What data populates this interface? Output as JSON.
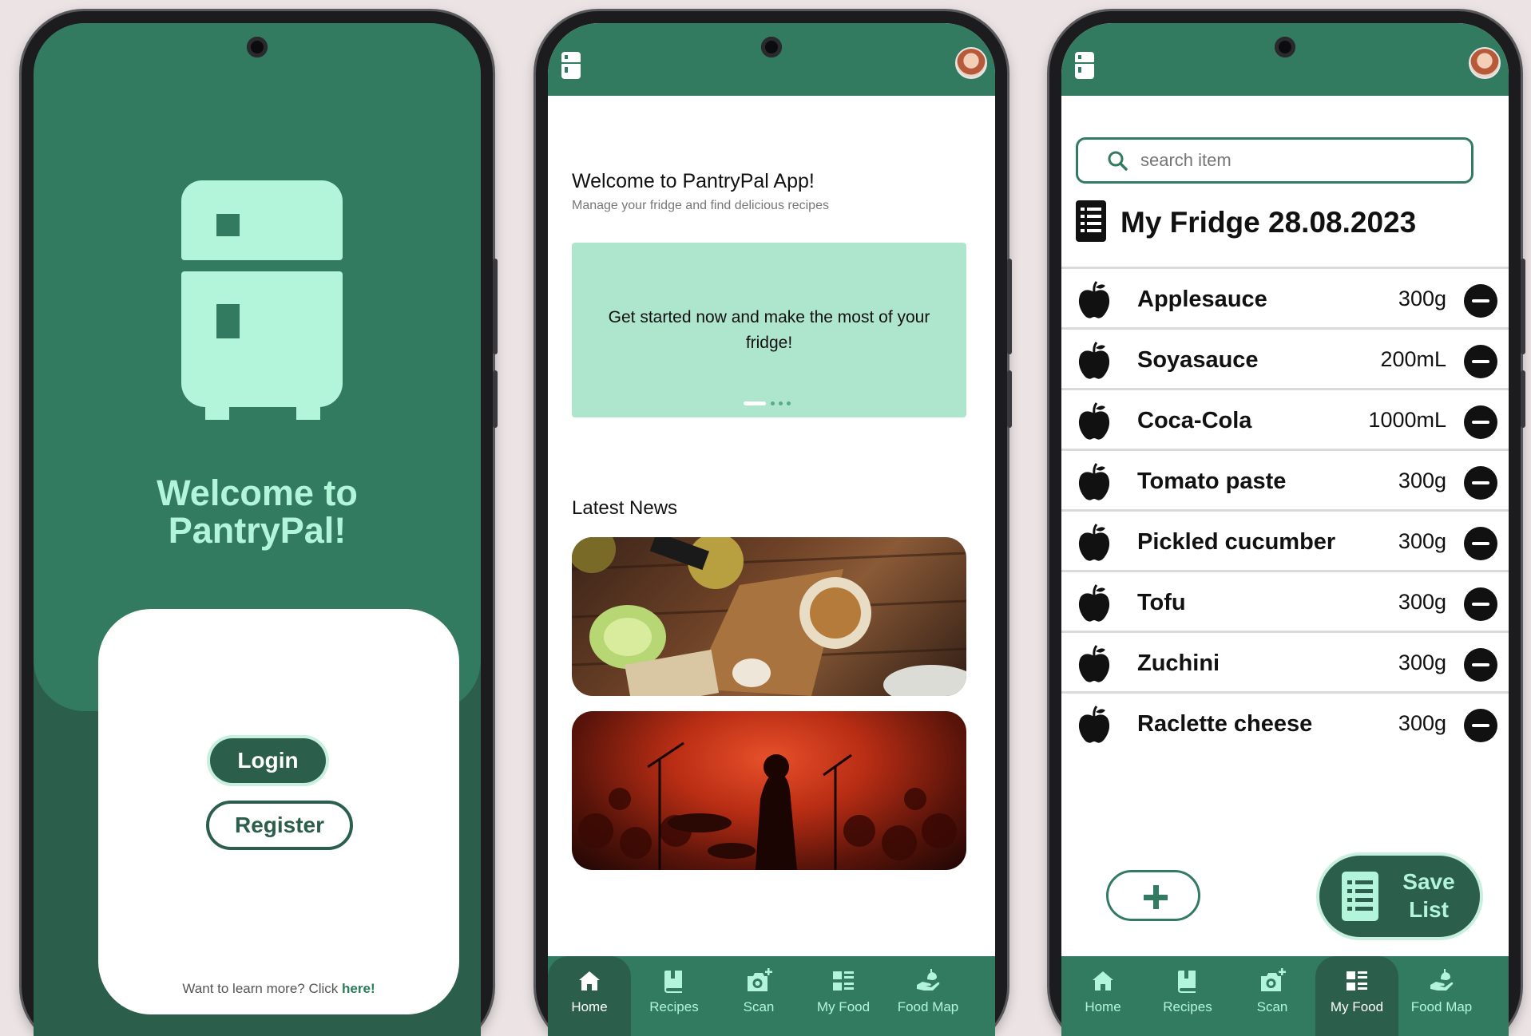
{
  "login_screen": {
    "title_line1": "Welcome to",
    "title_line2": "PantryPal!",
    "login_label": "Login",
    "register_label": "Register",
    "learn_more_text": "Want to learn more? Click ",
    "learn_more_link": "here!"
  },
  "home_screen": {
    "welcome_title": "Welcome to PantryPal App!",
    "welcome_subtitle": "Manage your fridge and find delicious recipes",
    "banner_text": "Get started now and make the most of your fridge!",
    "carousel": {
      "total": 4,
      "active": 1
    },
    "news_title": "Latest News"
  },
  "fridge_screen": {
    "search_placeholder": "search item",
    "title": "My Fridge 28.08.2023",
    "items": [
      {
        "name": "Applesauce",
        "qty": "300g"
      },
      {
        "name": "Soyasauce",
        "qty": "200mL"
      },
      {
        "name": "Coca-Cola",
        "qty": "1000mL"
      },
      {
        "name": "Tomato paste",
        "qty": "300g"
      },
      {
        "name": "Pickled cucumber",
        "qty": "300g"
      },
      {
        "name": "Tofu",
        "qty": "300g"
      },
      {
        "name": "Zuchini",
        "qty": "300g"
      },
      {
        "name": "Raclette cheese",
        "qty": "300g"
      }
    ],
    "save_label_line1": "Save",
    "save_label_line2": "List"
  },
  "nav": {
    "home": "Home",
    "recipes": "Recipes",
    "scan": "Scan",
    "my_food": "My Food",
    "food_map": "Food Map"
  },
  "icons": {
    "app": "fridge-icon",
    "avatar": "user-avatar",
    "search": "search-icon",
    "list_doc": "document-list-icon",
    "item": "apple-icon",
    "remove": "minus-circle-icon",
    "add": "plus-icon",
    "nav_home": "home-icon",
    "nav_recipes": "book-icon",
    "nav_scan": "camera-icon",
    "nav_my_food": "list-icon",
    "nav_food_map": "hand-share-icon"
  },
  "colors": {
    "primary": "#337b60",
    "primary_dark": "#2b5f4b",
    "accent_mint": "#b3f5db",
    "banner": "#aee6cd",
    "background": "#ebe3e4"
  }
}
